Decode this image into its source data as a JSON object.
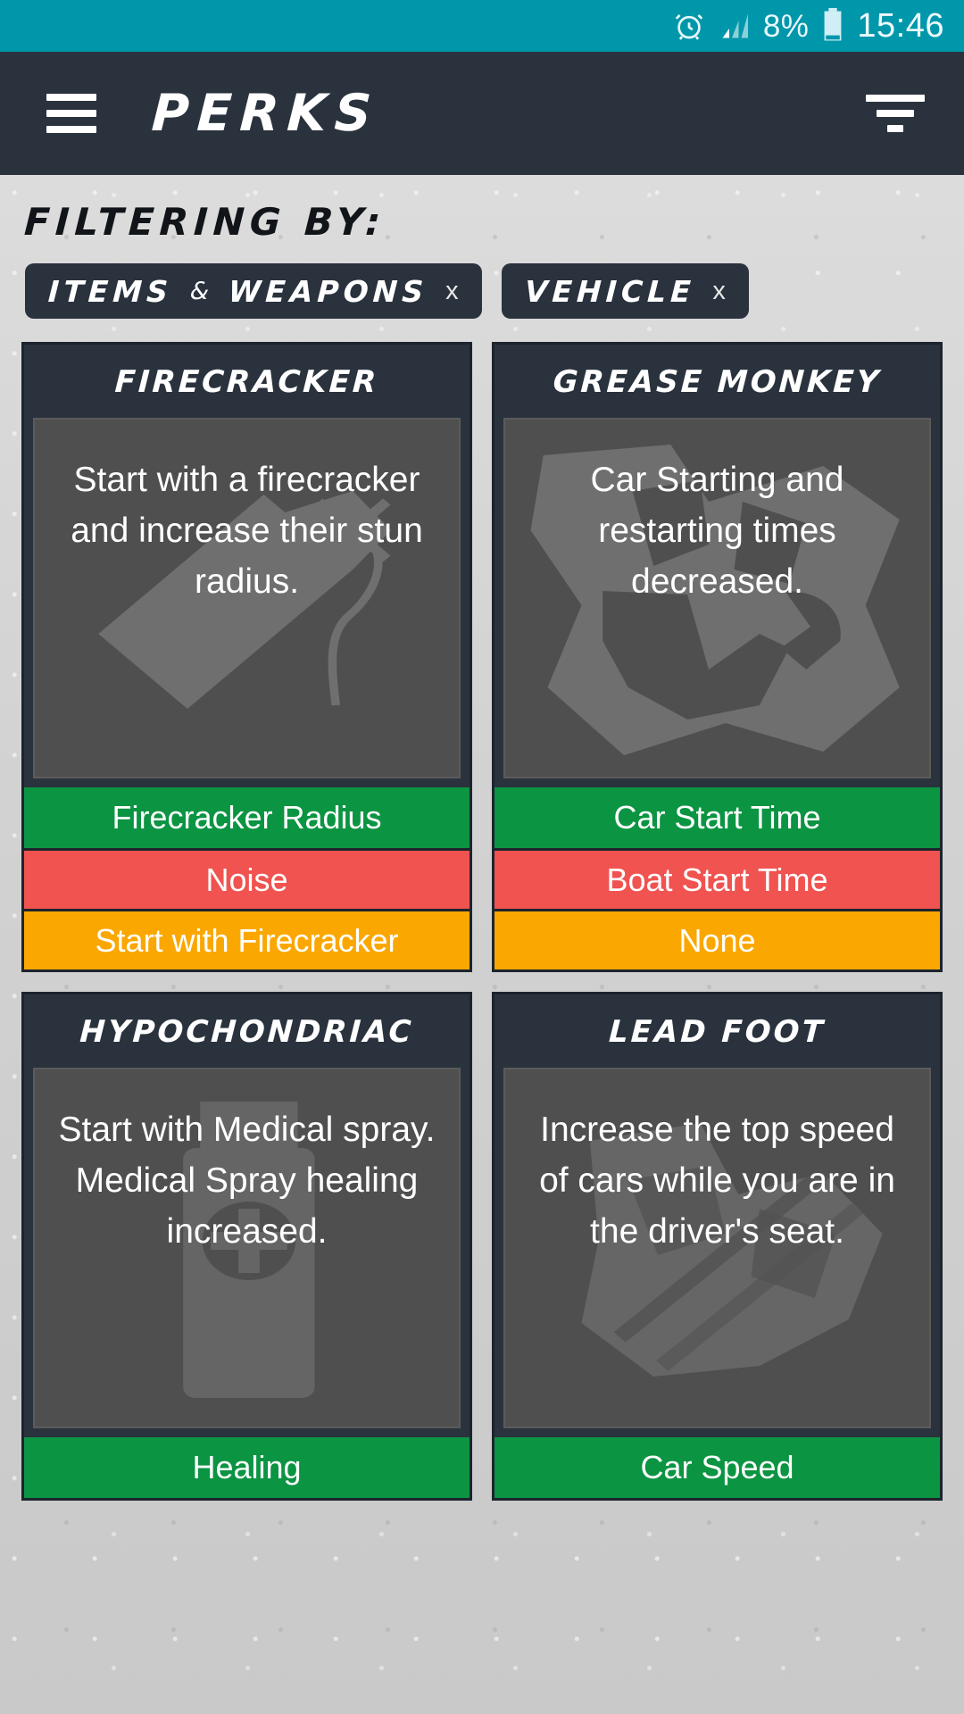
{
  "statusbar": {
    "alarm_icon": "alarm-clock-icon",
    "signal_icon": "cellular-signal-icon",
    "battery_percent": "8%",
    "battery_icon": "battery-icon",
    "clock": "15:46",
    "bg_color": "#0097ab"
  },
  "appbar": {
    "menu_icon": "hamburger-menu-icon",
    "title": "PERKS",
    "filter_icon": "filter-icon",
    "bg_color": "#2a323d"
  },
  "filtering": {
    "label": "FILTERING BY:",
    "chips": [
      {
        "label": "ITEMS",
        "amp": "&",
        "label2": "WEAPONS",
        "remove": "x"
      },
      {
        "label": "VEHICLE",
        "amp": "",
        "label2": "",
        "remove": "x"
      }
    ]
  },
  "colors": {
    "good": "#0b9442",
    "bad": "#f05350",
    "neutral": "#fba701",
    "card_bg": "#2a323d",
    "card_border": "#1d242d",
    "art_bg": "#4f4f4f"
  },
  "cards": [
    {
      "title": "FIRECRACKER",
      "art": "firecracker-art",
      "description": "Start with a firecracker and increase their stun radius.",
      "stats": [
        {
          "label": "Firecracker Radius",
          "kind": "good"
        },
        {
          "label": "Noise",
          "kind": "bad"
        },
        {
          "label": "Start with Firecracker",
          "kind": "neutral"
        }
      ]
    },
    {
      "title": "GREASE MONKEY",
      "art": "wrench-art",
      "description": "Car Starting and restarting times decreased.",
      "stats": [
        {
          "label": "Car Start Time",
          "kind": "good"
        },
        {
          "label": "Boat Start Time",
          "kind": "bad"
        },
        {
          "label": "None",
          "kind": "neutral"
        }
      ]
    },
    {
      "title": "HYPOCHONDRIAC",
      "art": "medical-spray-art",
      "description": "Start with Medical spray. Medical Spray healing increased.",
      "stats": [
        {
          "label": "Healing",
          "kind": "good"
        }
      ]
    },
    {
      "title": "LEAD FOOT",
      "art": "boot-pedal-art",
      "description": "Increase the top speed of cars while you are in the driver's seat.",
      "stats": [
        {
          "label": "Car Speed",
          "kind": "good"
        }
      ]
    }
  ]
}
